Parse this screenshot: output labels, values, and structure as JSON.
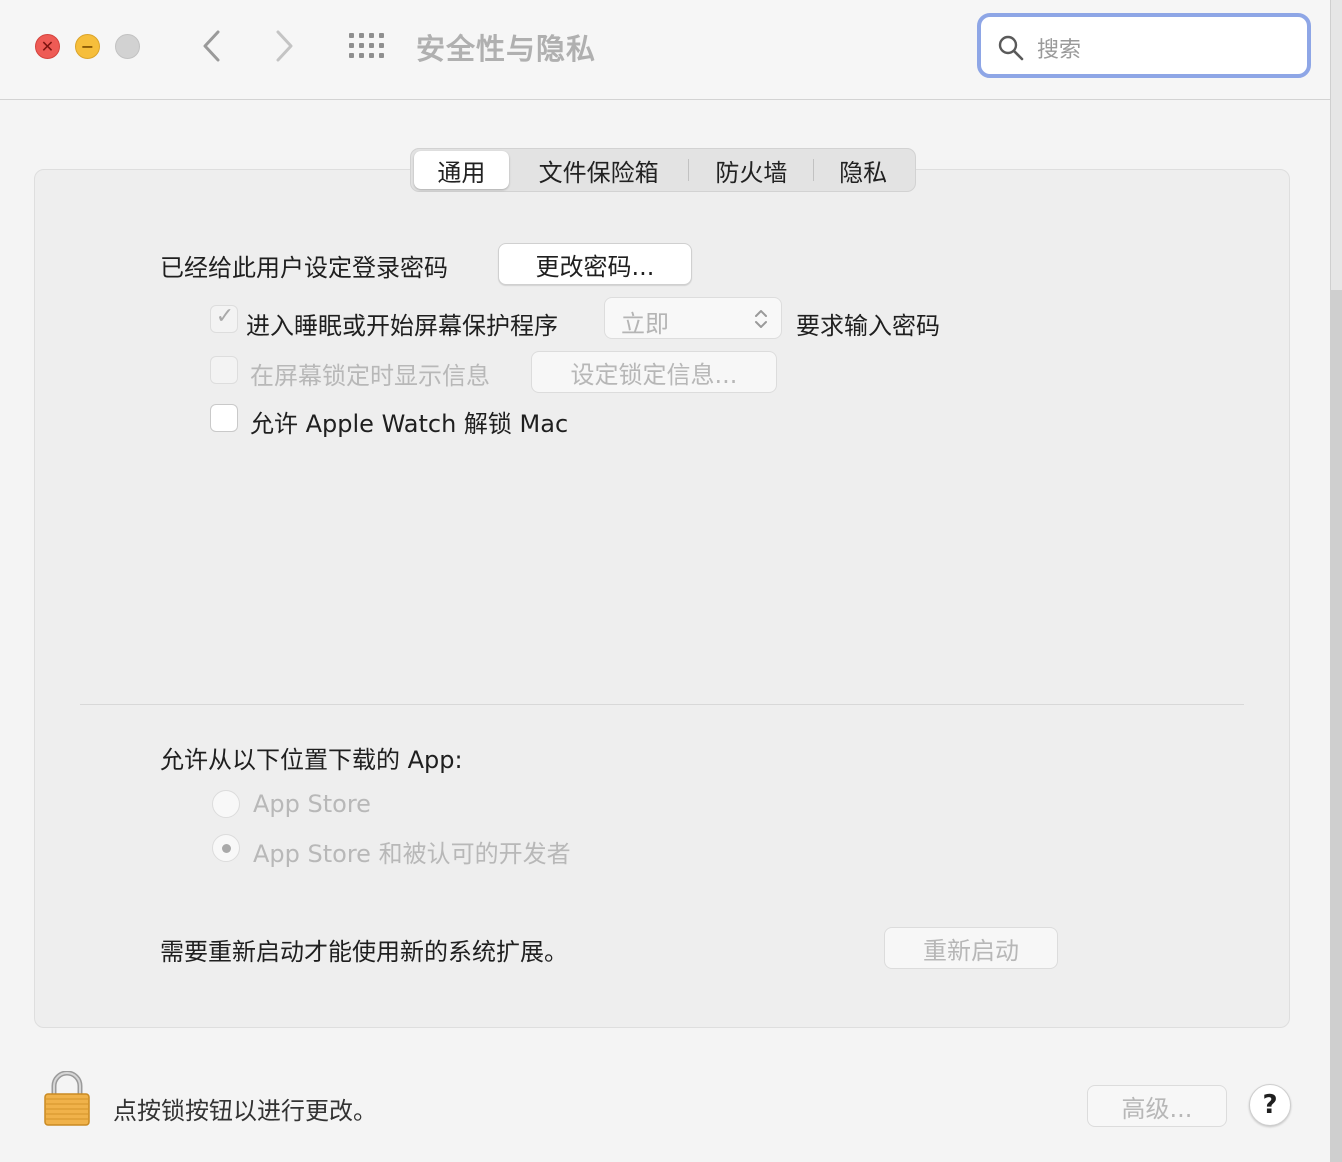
{
  "window": {
    "title": "安全性与隐私",
    "close_glyph": "✕",
    "minimize_glyph": "−"
  },
  "toolbar": {
    "icons": [
      "chevron-left-icon",
      "chevron-right-icon",
      "grid-icon"
    ],
    "search": {
      "placeholder": "搜索",
      "value": ""
    }
  },
  "tabs": [
    {
      "label": "通用",
      "selected": true
    },
    {
      "label": "文件保险箱",
      "selected": false
    },
    {
      "label": "防火墙",
      "selected": false
    },
    {
      "label": "隐私",
      "selected": false
    }
  ],
  "general": {
    "password_label": "已经给此用户设定登录密码",
    "change_password_button": "更改密码...",
    "sleep_checkbox": {
      "label": "进入睡眠或开始屏幕保护程序",
      "checked": true,
      "enabled": false
    },
    "require_popup": {
      "value": "立即",
      "enabled": false
    },
    "require_suffix": "要求输入密码",
    "lock_message_checkbox": {
      "label": "在屏幕锁定时显示信息",
      "checked": false,
      "enabled": false
    },
    "set_lock_message_button": "设定锁定信息...",
    "apple_watch_checkbox": {
      "label": "允许 Apple Watch 解锁 Mac",
      "checked": false,
      "enabled": true
    }
  },
  "downloads": {
    "heading": "允许从以下位置下载的 App:",
    "options": [
      {
        "label": "App Store",
        "selected": false
      },
      {
        "label": "App Store 和被认可的开发者",
        "selected": true
      }
    ]
  },
  "extensions": {
    "message": "需要重新启动才能使用新的系统扩展。",
    "restart_button": "重新启动"
  },
  "footer": {
    "lock_text": "点按锁按钮以进行更改。",
    "advanced_button": "高级...",
    "help_button": "?"
  },
  "colors": {
    "search_focus": "#8ea6e6",
    "close": "#ee5b55",
    "minimize": "#f6be3b",
    "lock_gold": "#f0b24a"
  }
}
